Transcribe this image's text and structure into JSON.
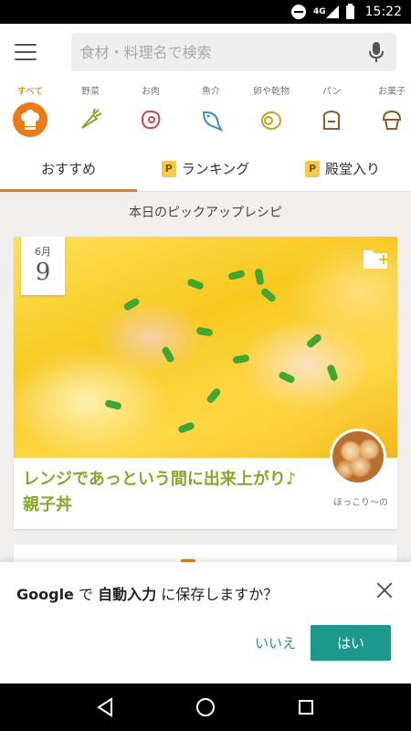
{
  "status": {
    "network": "4G",
    "time": "15:22"
  },
  "search": {
    "placeholder": "食材・料理名で検索"
  },
  "categories": [
    {
      "label": "すべて",
      "icon": "chef-hat-icon"
    },
    {
      "label": "野菜",
      "icon": "carrot-icon"
    },
    {
      "label": "お肉",
      "icon": "meat-icon"
    },
    {
      "label": "魚介",
      "icon": "fish-icon"
    },
    {
      "label": "卵や乾物",
      "icon": "egg-icon"
    },
    {
      "label": "パン",
      "icon": "bread-icon"
    },
    {
      "label": "お菓子",
      "icon": "muffin-icon"
    }
  ],
  "tabs": [
    {
      "label": "おすすめ"
    },
    {
      "label": "ランキング",
      "badge": "P"
    },
    {
      "label": "殿堂入り",
      "badge": "P"
    }
  ],
  "section_title": "本日のピックアップレシピ",
  "card": {
    "month": "6月",
    "day": "9",
    "title": "レンジであっという間に出来上がり♪親子丼",
    "author": "ほっこり〜の"
  },
  "autofill": {
    "prefix": "Google",
    "middle": " で ",
    "bold": "自動入力",
    "suffix": " に保存しますか？",
    "no": "いいえ",
    "yes": "はい"
  },
  "colors": {
    "accent": "#ec7a17",
    "teal": "#1d998b",
    "title_green": "#8aa82a"
  }
}
